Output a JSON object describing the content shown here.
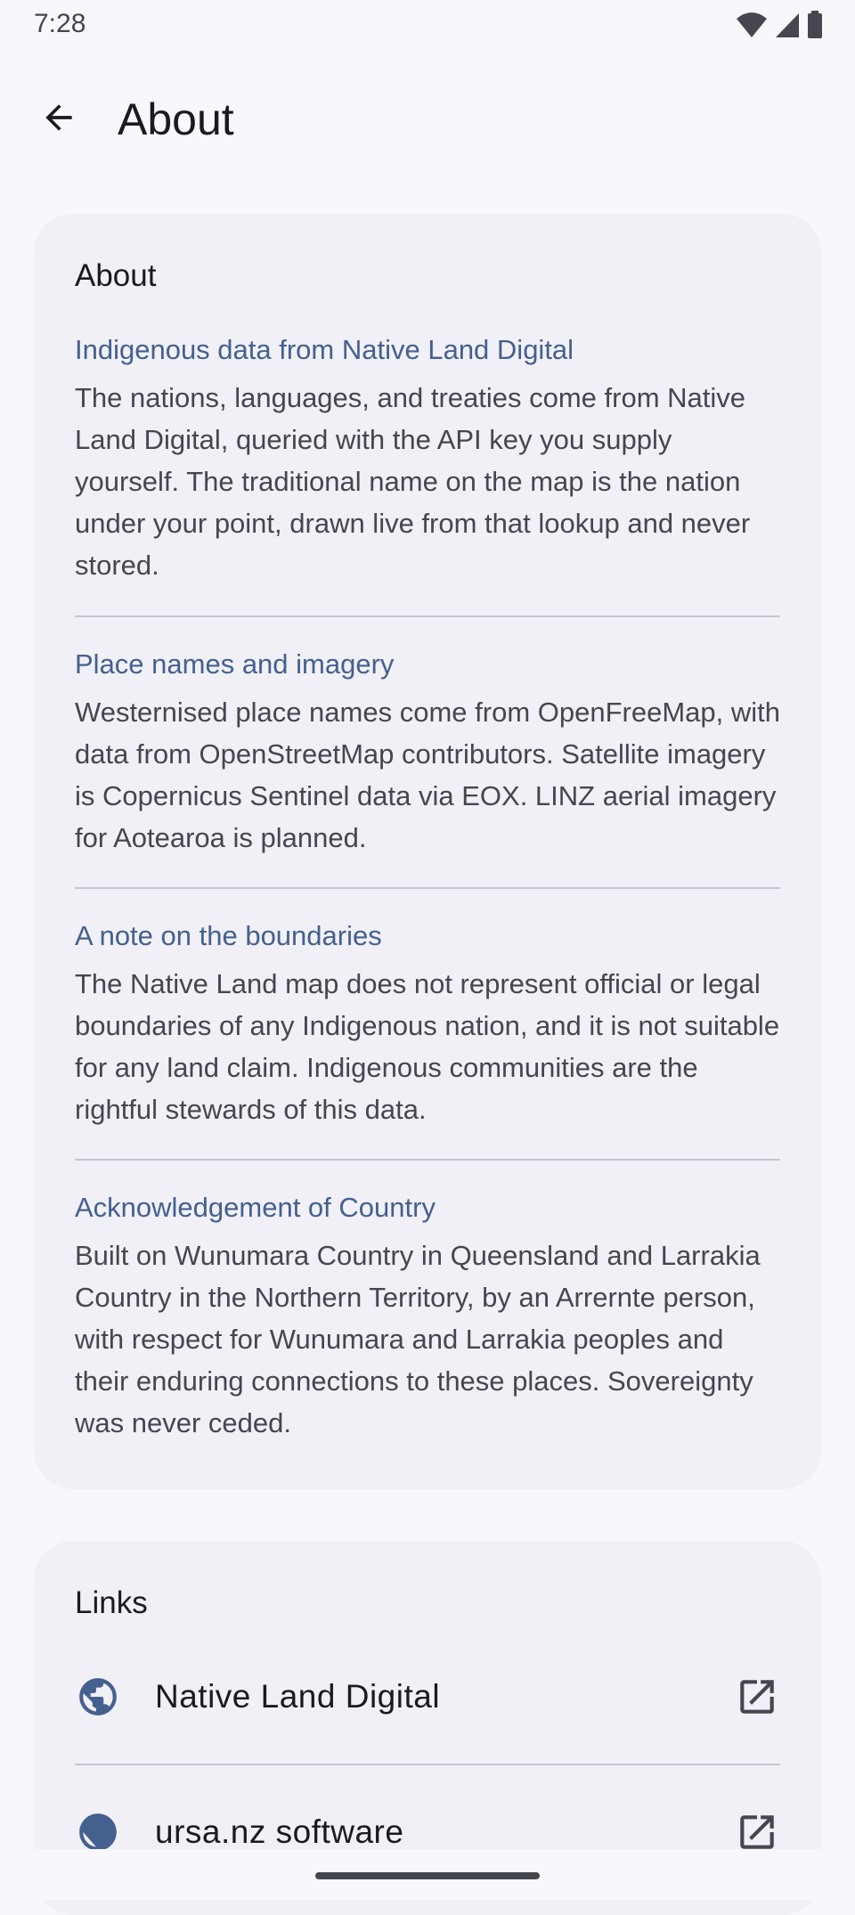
{
  "status_bar": {
    "time": "7:28"
  },
  "app_bar": {
    "title": "About",
    "back_icon": "arrow-back-icon"
  },
  "about_card": {
    "heading": "About",
    "sections": [
      {
        "title": "Indigenous data from Native Land Digital",
        "body": "The nations, languages, and treaties come from Native Land Digital, queried with the API key you supply yourself. The traditional name on the map is the nation under your point, drawn live from that lookup and never stored."
      },
      {
        "title": "Place names and imagery",
        "body": "Westernised place names come from OpenFreeMap, with data from OpenStreetMap contributors. Satellite imagery is Copernicus Sentinel data via EOX. LINZ aerial imagery for Aotearoa is planned."
      },
      {
        "title": "A note on the boundaries",
        "body": "The Native Land map does not represent official or legal boundaries of any Indigenous nation, and it is not suitable for any land claim. Indigenous communities are the rightful stewards of this data."
      },
      {
        "title": "Acknowledgement of Country",
        "body": "Built on Wunumara Country in Queensland and Larrakia Country in the Northern Territory, by an Arrernte person, with respect for Wunumara and Larrakia peoples and their enduring connections to these places. Sovereignty was never ceded."
      }
    ]
  },
  "links_card": {
    "heading": "Links",
    "items": [
      {
        "label": "Native Land Digital",
        "icon": "globe-icon",
        "trailing_icon": "open-in-new-icon"
      },
      {
        "label": "ursa.nz software",
        "icon": "globe-icon",
        "trailing_icon": "open-in-new-icon"
      }
    ]
  },
  "colors": {
    "background": "#f8f7fc",
    "card": "#f1f0f6",
    "section_title": "#44608f",
    "body_text": "#45464f",
    "icon_accent": "#44608f"
  }
}
